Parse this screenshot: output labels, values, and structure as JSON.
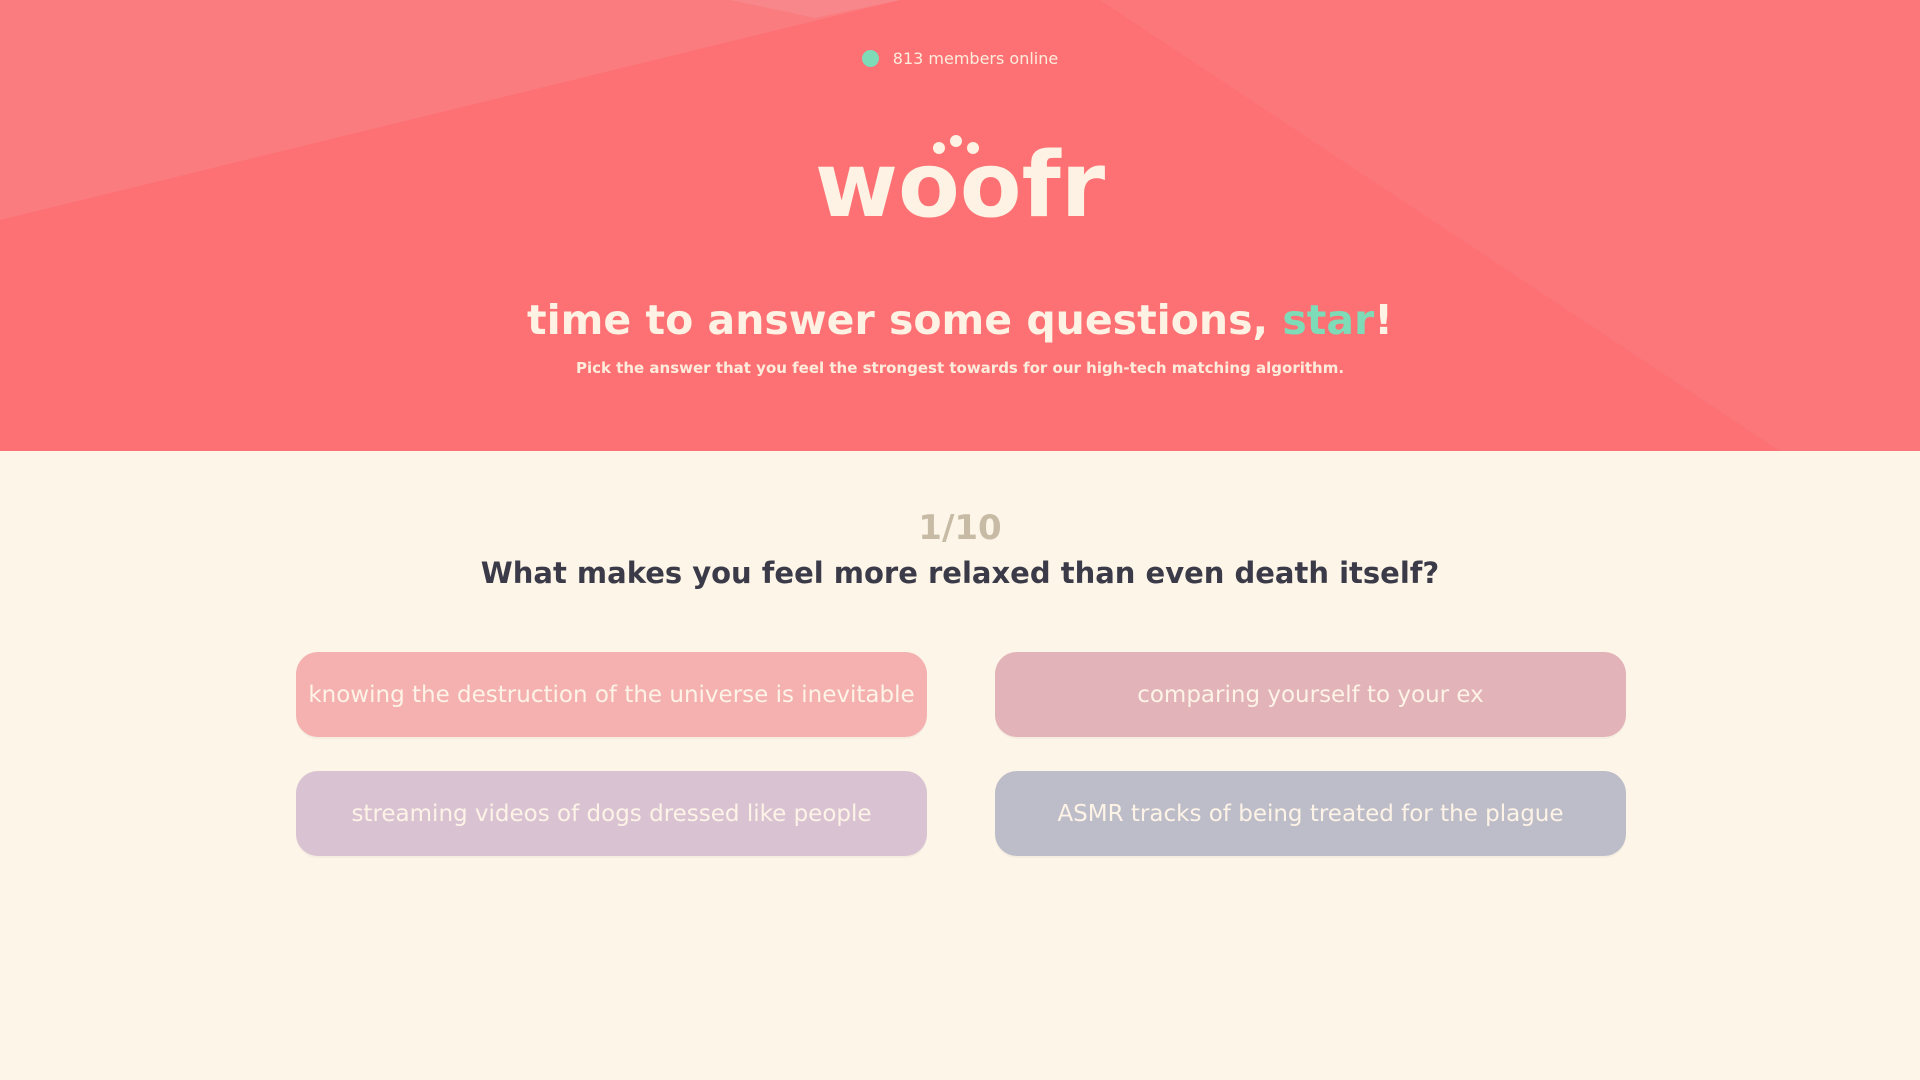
{
  "status": {
    "text": "813 members online",
    "dot_color": "#7edbb8",
    "icon": "online-status-dot-icon"
  },
  "brand": {
    "name": "woofr",
    "text_color": "#fdf2e3"
  },
  "hero": {
    "background_color": "#fd7174",
    "title_prefix": "time to answer some questions, ",
    "title_name": "star",
    "title_suffix": "!",
    "accent_color": "#7edbb8",
    "subtitle": "Pick the answer that you feel the strongest towards for our high-tech matching algorithm."
  },
  "quiz": {
    "progress": "1/10",
    "question": "What makes you feel more relaxed than even death itself?",
    "answers": [
      {
        "label": "knowing the destruction of the universe is inevitable",
        "color": "#f4b1b0"
      },
      {
        "label": "comparing yourself to your ex",
        "color": "#e2b3b8"
      },
      {
        "label": "streaming videos of dogs dressed like people",
        "color": "#d9c3d3"
      },
      {
        "label": "ASMR tracks of being treated for the plague",
        "color": "#bdbdc9"
      }
    ]
  }
}
